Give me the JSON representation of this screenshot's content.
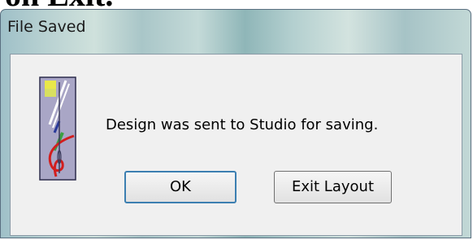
{
  "background": {
    "partial_text": "on Exit."
  },
  "dialog": {
    "title": "File Saved",
    "message": "Design was sent to Studio for saving.",
    "icon": "needle-thread-icon",
    "buttons": {
      "ok_label": "OK",
      "exit_label": "Exit Layout"
    }
  },
  "colors": {
    "client_background": "#f0f0f0",
    "default_button_border": "#3c7fb1",
    "frame_glass": "#b9d2d2"
  }
}
